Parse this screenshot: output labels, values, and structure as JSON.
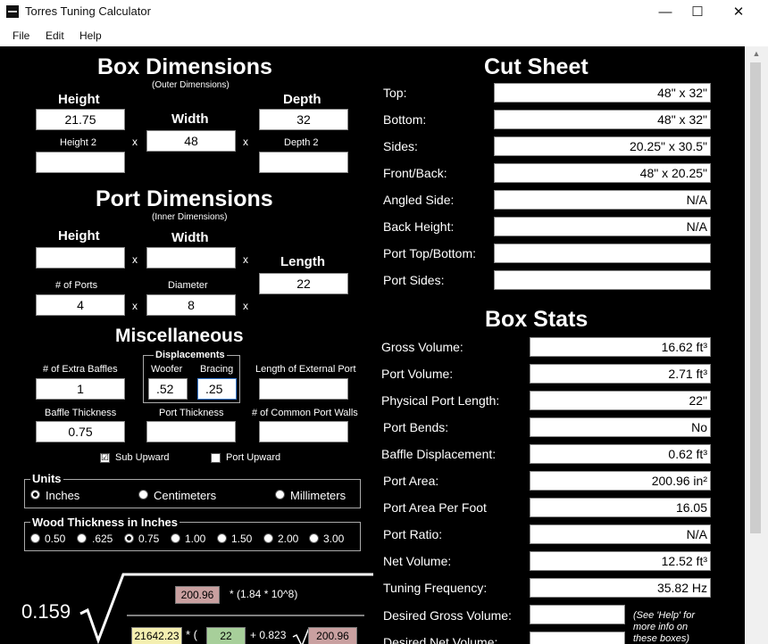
{
  "window": {
    "title": "Torres Tuning Calculator",
    "minimize": "—",
    "maximize": "☐",
    "close": "✕"
  },
  "menu": {
    "file": "File",
    "edit": "Edit",
    "help": "Help"
  },
  "box_dimensions": {
    "title": "Box Dimensions",
    "subtitle": "(Outer Dimensions)",
    "height_label": "Height",
    "height_value": "21.75",
    "height2_label": "Height 2",
    "height2_value": "",
    "width_label": "Width",
    "width_value": "48",
    "depth_label": "Depth",
    "depth_value": "32",
    "depth2_label": "Depth 2",
    "depth2_value": "",
    "times": "x"
  },
  "port_dimensions": {
    "title": "Port Dimensions",
    "subtitle": "(Inner Dimensions)",
    "height_label": "Height",
    "height_value": "",
    "width_label": "Width",
    "width_value": "",
    "length_label": "Length",
    "length_value": "22",
    "num_ports_label": "# of Ports",
    "num_ports_value": "4",
    "diameter_label": "Diameter",
    "diameter_value": "8"
  },
  "misc": {
    "title": "Miscellaneous",
    "extra_baffles_label": "# of Extra Baffles",
    "extra_baffles_value": "1",
    "displacements_label": "Displacements",
    "woofer_label": "Woofer",
    "woofer_value": ".52",
    "bracing_label": "Bracing",
    "bracing_value": ".25",
    "ext_port_label": "Length of External Port",
    "ext_port_value": "",
    "baffle_thickness_label": "Baffle Thickness",
    "baffle_thickness_value": "0.75",
    "port_thickness_label": "Port Thickness",
    "port_thickness_value": "",
    "common_walls_label": "# of Common Port Walls",
    "common_walls_value": "",
    "sub_upward_label": "Sub Upward",
    "sub_upward_check": "☑",
    "port_upward_label": "Port Upward"
  },
  "units": {
    "title": "Units",
    "options": [
      "Inches",
      "Centimeters",
      "Millimeters"
    ],
    "selected": "Inches"
  },
  "wood": {
    "title": "Wood Thickness in Inches",
    "options": [
      "0.50",
      ".625",
      "0.75",
      "1.00",
      "1.50",
      "2.00",
      "3.00"
    ],
    "selected": "0.75"
  },
  "formula": {
    "coef": "0.159",
    "area_value": "200.96",
    "mult_text": "* (1.84 * 10^8)",
    "volume_value": "21642.23",
    "paren_text": "* (",
    "length_value": "22",
    "plus_text": "+ 0.823",
    "area_value2": "200.96"
  },
  "cut_sheet": {
    "title": "Cut Sheet",
    "rows": [
      {
        "label": "Top:",
        "value": "48\" x 32\""
      },
      {
        "label": "Bottom:",
        "value": "48\" x 32\""
      },
      {
        "label": "Sides:",
        "value": "20.25\" x 30.5\""
      },
      {
        "label": "Front/Back:",
        "value": "48\" x 20.25\""
      },
      {
        "label": "Angled Side:",
        "value": "N/A"
      },
      {
        "label": "Back Height:",
        "value": "N/A"
      },
      {
        "label": "Port Top/Bottom:",
        "value": ""
      },
      {
        "label": "Port Sides:",
        "value": ""
      }
    ]
  },
  "box_stats": {
    "title": "Box Stats",
    "rows": [
      {
        "label": "Gross Volume:",
        "value": "16.62 ft³"
      },
      {
        "label": "Port Volume:",
        "value": "2.71 ft³"
      },
      {
        "label": "Physical Port Length:",
        "value": "22\""
      },
      {
        "label": "Port Bends:",
        "value": "No"
      },
      {
        "label": "Baffle Displacement:",
        "value": "0.62 ft³"
      },
      {
        "label": "Port Area:",
        "value": "200.96 in²"
      },
      {
        "label": "Port Area Per Foot",
        "value": "16.05"
      },
      {
        "label": "Port Ratio:",
        "value": "N/A"
      },
      {
        "label": "Net Volume:",
        "value": "12.52 ft³"
      },
      {
        "label": "Tuning Frequency:",
        "value": "35.82 Hz"
      }
    ],
    "desired_gross_label": "Desired Gross Volume:",
    "desired_gross_value": "",
    "desired_net_label": "Desired Net Volume:",
    "desired_net_value": "",
    "help_note": "(See 'Help' for more info on these boxes)"
  },
  "colors": {
    "background": "#000000",
    "pink_box": "#c9a0a0",
    "yellow_box": "#f4efb0",
    "green_box": "#a7cf9a"
  }
}
